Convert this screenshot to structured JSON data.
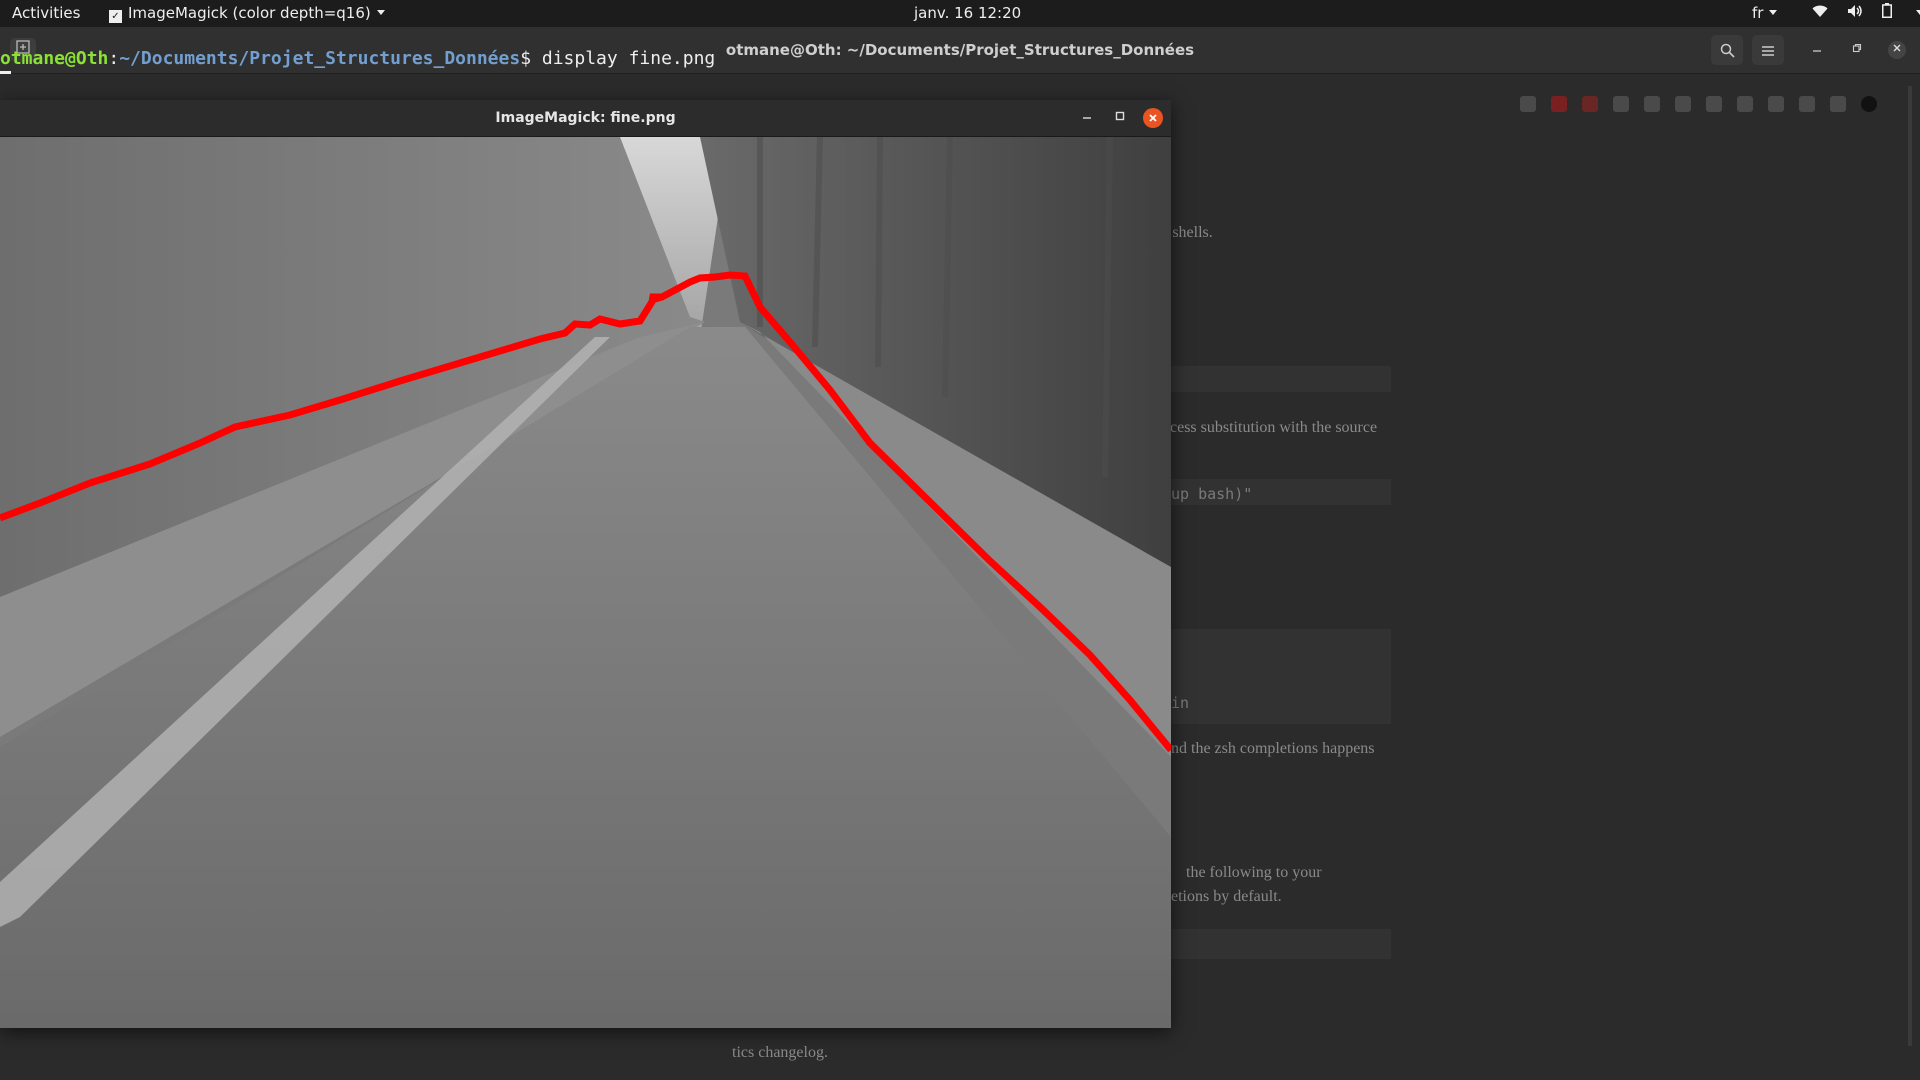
{
  "topbar": {
    "activities": "Activities",
    "app_name": "ImageMagick (color depth=q16)",
    "clock": "janv. 16  12:20",
    "language": "fr"
  },
  "terminal": {
    "title": "otmane@Oth: ~/Documents/Projet_Structures_Données",
    "prompt_user": "otmane@Oth",
    "prompt_colon": ":",
    "prompt_path": "~/Documents/Projet_Structures_Données",
    "prompt_symbol": "$ ",
    "command": "display fine.png"
  },
  "background_page": {
    "lines": [
      "r shells.",
      "cess substitution with the source",
      "up bash)\"",
      "in",
      "nd the zsh completions happens",
      "the    following    to    your",
      "etions by default.",
      "tics changelog."
    ]
  },
  "imagemagick": {
    "title": "ImageMagick: fine.png",
    "image": {
      "description_colors": {
        "line": "#ff0000"
      }
    }
  },
  "icons": {
    "app": "imagemagick-icon",
    "wifi": "wifi-icon",
    "volume": "volume-icon",
    "battery": "battery-icon"
  }
}
